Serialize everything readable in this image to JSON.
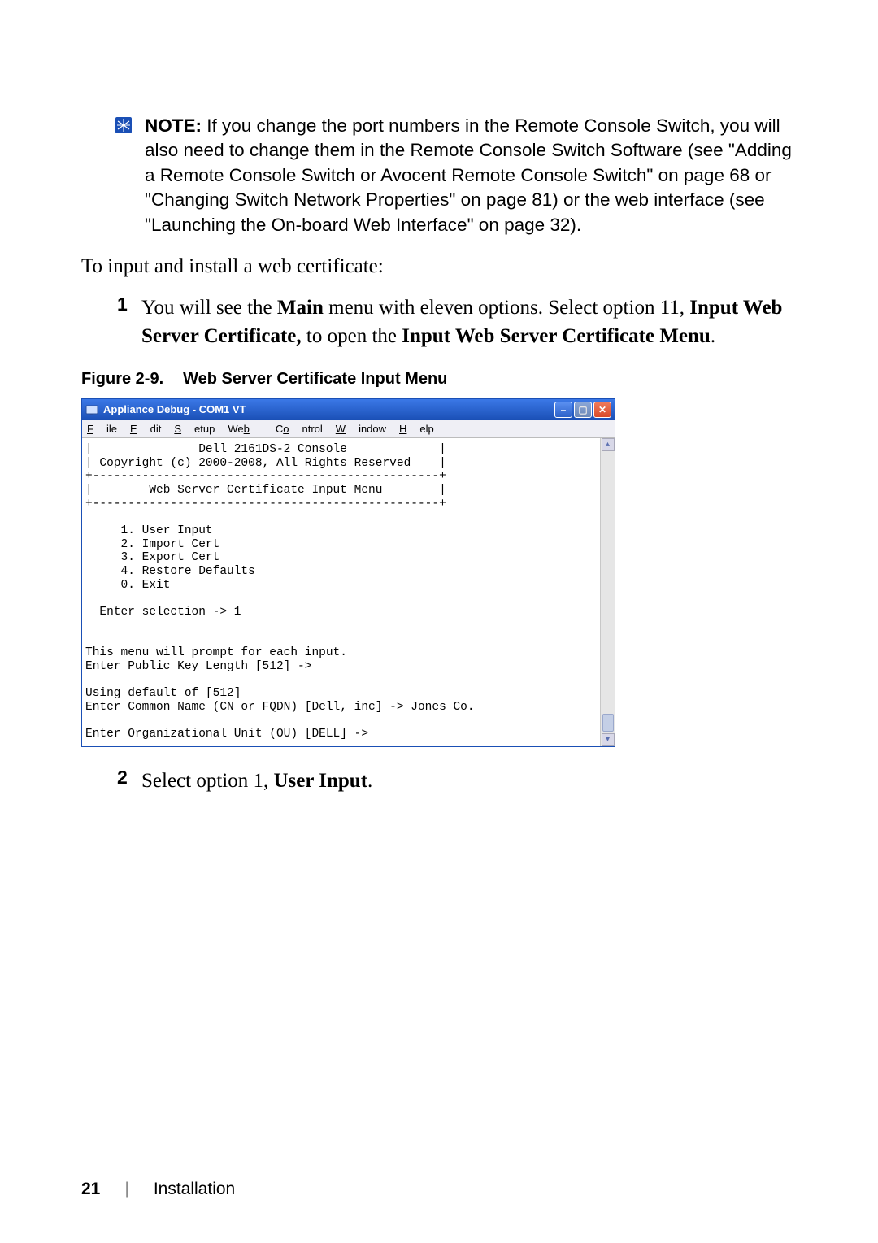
{
  "note": {
    "label": "NOTE:",
    "text": " If you change the port numbers in the Remote Console Switch, you will also need to change them in the Remote Console Switch Software (see \"Adding a Remote Console Switch or Avocent Remote Console Switch\" on page 68 or \"Changing Switch Network Properties\" on page 81) or the web interface (see \"Launching the On-board Web Interface\" on page 32)."
  },
  "intro": "To input and install a web certificate:",
  "step1": {
    "num": "1",
    "parts": {
      "a": "You will see the ",
      "b": "Main",
      "c": " menu with eleven options. Select option 11, ",
      "d": "Input Web Server Certificate,",
      "e": " to open the ",
      "f": "Input Web Server Certificate Menu",
      "g": "."
    }
  },
  "figure": {
    "label": "Figure 2-9.",
    "title": "Web Server Certificate Input Menu"
  },
  "terminal": {
    "title": "Appliance Debug - COM1 VT",
    "menus": {
      "file": "File",
      "edit": "Edit",
      "setup": "Setup",
      "web": "Web",
      "control": "Control",
      "window": "Window",
      "help": "Help"
    },
    "body": "|               Dell 2161DS-2 Console             |\n| Copyright (c) 2000-2008, All Rights Reserved    |\n+-------------------------------------------------+\n|        Web Server Certificate Input Menu        |\n+-------------------------------------------------+\n\n     1. User Input\n     2. Import Cert\n     3. Export Cert\n     4. Restore Defaults\n     0. Exit\n\n  Enter selection -> 1\n\n\nThis menu will prompt for each input.\nEnter Public Key Length [512] ->\n\nUsing default of [512]\nEnter Common Name (CN or FQDN) [Dell, inc] -> Jones Co.\n\nEnter Organizational Unit (OU) [DELL] ->"
  },
  "step2": {
    "num": "2",
    "parts": {
      "a": "Select option 1, ",
      "b": "User Input",
      "c": "."
    }
  },
  "footer": {
    "page": "21",
    "section": "Installation"
  }
}
